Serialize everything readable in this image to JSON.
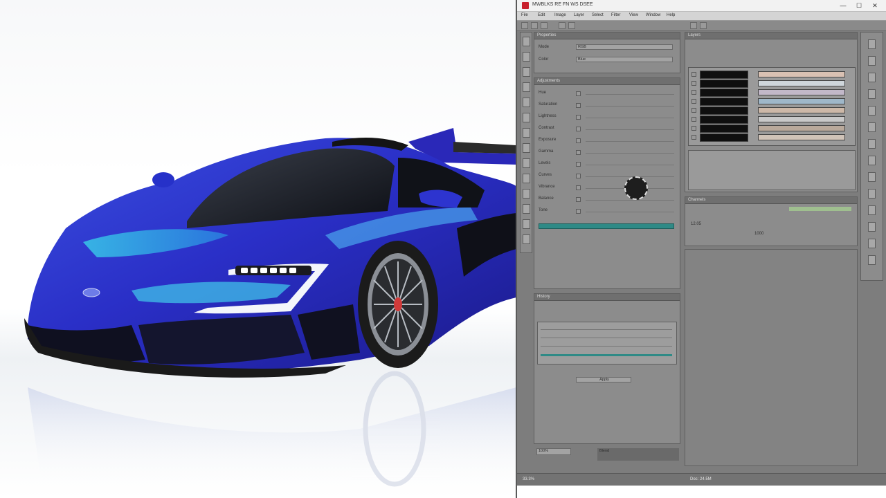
{
  "window": {
    "title": "MWBLKS RE FN WS DSEE",
    "controls": {
      "minimize": "—",
      "maximize": "☐",
      "close": "✕"
    }
  },
  "menu": [
    "File",
    "Edit",
    "Image",
    "Layer",
    "Select",
    "Filter",
    "View",
    "Window",
    "Help"
  ],
  "left_panel": {
    "header": "Properties",
    "group1": {
      "row1_label": "Mode",
      "row1_value": "RGB",
      "row2_label": "Color",
      "row2_value": "Blue"
    },
    "group2_header": "Adjustments",
    "group2_rows": [
      "Hue",
      "Saturation",
      "Lightness",
      "Contrast",
      "Exposure",
      "Gamma",
      "Levels",
      "Curves",
      "Vibrance",
      "Balance",
      "Tone"
    ],
    "accent_bar": "#2f8a86"
  },
  "lower_left_panel": {
    "header": "History",
    "footer": "Apply"
  },
  "bottom_fields": {
    "f1": "100%",
    "f2": "Blend"
  },
  "layers_panel": {
    "header": "Layers",
    "swatches": [
      "#d9c1b3",
      "#cfd6db",
      "#c2b8c9",
      "#9fb7c9",
      "#cdb8a8",
      "#c9c9c9",
      "#b9a99b",
      "#d0c3b8"
    ]
  },
  "mid_right_panel": {
    "header": "Channels",
    "v1": "12.05",
    "v2": "1000"
  },
  "status": {
    "zoom": "33.3%",
    "info": "Doc: 24.5M"
  },
  "icons": [
    "app-logo-icon",
    "layer-visibility-icon",
    "tool-icon",
    "cursor-icon"
  ]
}
